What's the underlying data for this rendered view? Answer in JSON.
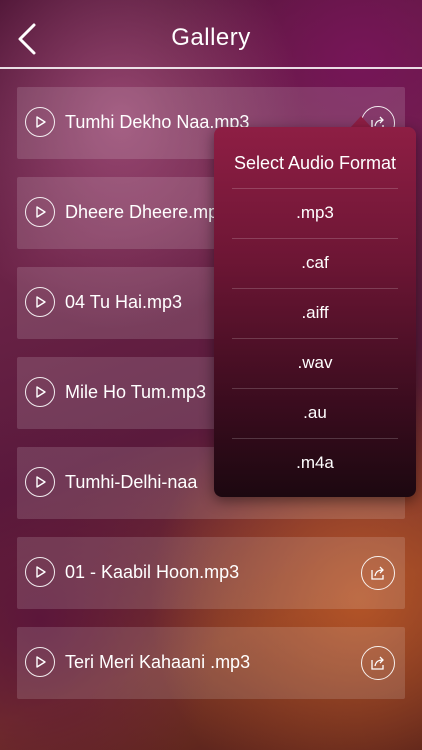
{
  "header": {
    "title": "Gallery"
  },
  "songs": [
    {
      "name": "Tumhi Dekho Naa.mp3"
    },
    {
      "name": "Dheere Dheere.mp3"
    },
    {
      "name": "04 Tu Hai.mp3"
    },
    {
      "name": "Mile Ho Tum.mp3"
    },
    {
      "name": "Tumhi-Delhi-naa"
    },
    {
      "name": "01 - Kaabil Hoon.mp3"
    },
    {
      "name": "Teri Meri Kahaani .mp3"
    }
  ],
  "format_menu": {
    "title": "Select Audio Format",
    "options": [
      ".mp3",
      ".caf",
      ".aiff",
      ".wav",
      ".au",
      ".m4a"
    ]
  },
  "icons": {
    "back": "chevron-left-icon",
    "play": "play-icon",
    "share": "share-icon"
  }
}
